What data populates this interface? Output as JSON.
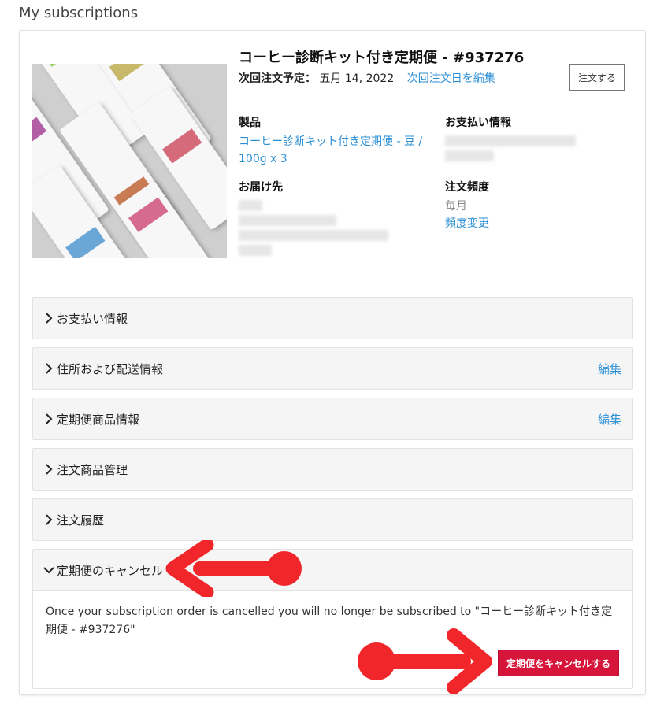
{
  "page": {
    "heading": "My subscriptions"
  },
  "subscription": {
    "title": "コーヒー診断キット付き定期便 - #937276",
    "next_order_label": "次回注文予定：",
    "next_order_date": "五月 14, 2022",
    "edit_next_date_link": "次回注文日を編集",
    "order_button": "注文する"
  },
  "details": {
    "product_heading": "製品",
    "product_link": "コーヒー診断キット付き定期便 - 豆 / 100g x 3",
    "payment_heading": "お支払い情報",
    "shipping_heading": "お届け先",
    "frequency_heading": "注文頻度",
    "frequency_value": "毎月",
    "frequency_change_link": "頻度変更"
  },
  "accordions": [
    {
      "label": "お支払い情報",
      "edit": ""
    },
    {
      "label": "住所および配送情報",
      "edit": "編集"
    },
    {
      "label": "定期便商品情報",
      "edit": "編集"
    },
    {
      "label": "注文商品管理",
      "edit": ""
    },
    {
      "label": "注文履歴",
      "edit": ""
    }
  ],
  "cancel_section": {
    "label": "定期便のキャンセル",
    "message": "Once your subscription order is cancelled you will no longer be subscribed to \"コーヒー診断キット付き定期便 - #937276\"",
    "button": "定期便をキャンセルする"
  },
  "colors": {
    "link": "#2b8fd6",
    "cancel_button": "#d7143a",
    "annotation_arrow": "#f0262a"
  },
  "icons": {
    "accordion_collapsed": "chevron-right-icon",
    "accordion_expanded": "chevron-down-icon",
    "annotation": "red-arrow-icon"
  }
}
